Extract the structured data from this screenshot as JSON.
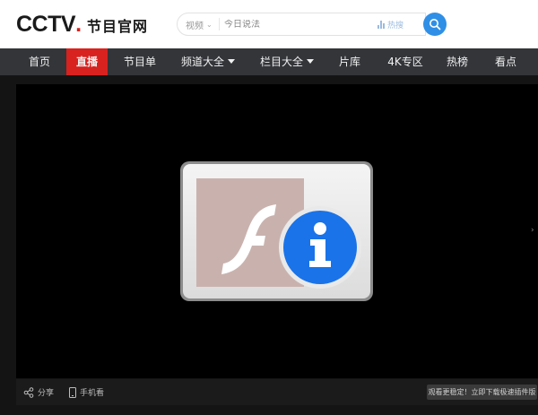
{
  "header": {
    "logo_mark": "CCTV",
    "logo_dot": ".",
    "logo_text": "节目官网",
    "search": {
      "type_label": "视频",
      "placeholder": "今日说法",
      "hot_label": "热搜"
    },
    "search_button_icon": "search-icon"
  },
  "nav": {
    "items": [
      {
        "label": "首页"
      },
      {
        "label": "直播",
        "active": true
      },
      {
        "label": "节目单"
      },
      {
        "label": "频道大全",
        "dropdown": true
      },
      {
        "label": "栏目大全",
        "dropdown": true
      },
      {
        "label": "片库"
      },
      {
        "label": "4K专区"
      },
      {
        "label": "热榜"
      },
      {
        "label": "看点"
      }
    ]
  },
  "player": {
    "plugin_icon": "flash-plugin-info-icon",
    "controls": {
      "share_label": "分享",
      "mobile_label": "手机看"
    },
    "tip": "观看更稳定！立即下载极速插件版"
  },
  "colors": {
    "brand_red": "#d8221f",
    "nav_bg": "#333539",
    "search_blue": "#2f8fe6",
    "info_blue": "#1a73e8"
  }
}
